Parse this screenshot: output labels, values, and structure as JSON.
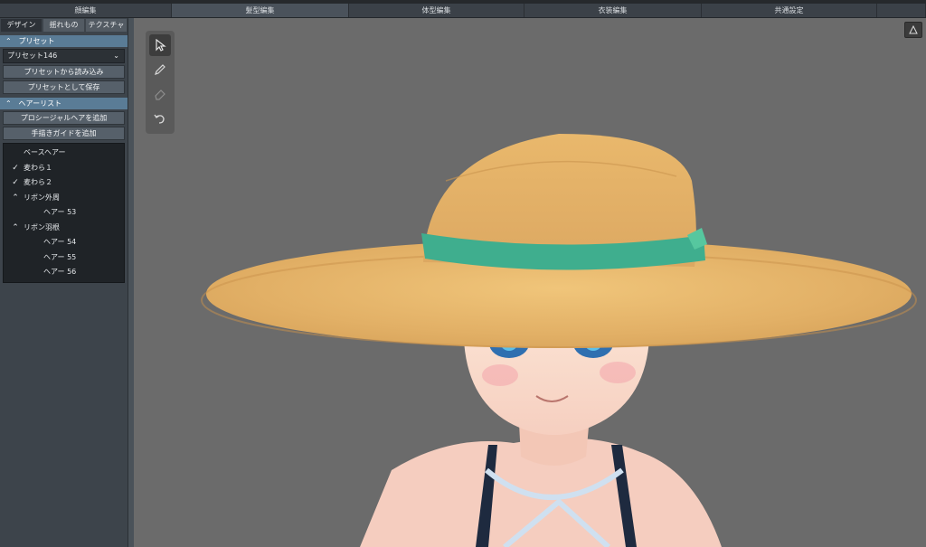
{
  "main_tabs": [
    "顔編集",
    "髪型編集",
    "体型編集",
    "衣装編集",
    "共通設定"
  ],
  "sub_tabs": [
    "デザイン",
    "揺れもの",
    "テクスチャ"
  ],
  "preset": {
    "header": "プリセット",
    "selected": "プリセット146",
    "load_button": "プリセットから読み込み",
    "save_button": "プリセットとして保存"
  },
  "hair_list": {
    "header": "ヘアーリスト",
    "add_procedural_button": "プロシージャルヘアを追加",
    "add_guide_button": "手描きガイドを追加",
    "items": [
      {
        "label": "ベースヘアー",
        "icon": "none",
        "level": 1
      },
      {
        "label": "麦わら１",
        "icon": "chevron-down",
        "level": 1
      },
      {
        "label": "麦わら２",
        "icon": "chevron-down",
        "level": 1
      },
      {
        "label": "リボン外周",
        "icon": "chevron-up",
        "level": 1
      },
      {
        "label": "ヘアー 53",
        "icon": "none",
        "level": 2
      },
      {
        "label": "リボン羽根",
        "icon": "chevron-up",
        "level": 1
      },
      {
        "label": "ヘアー 54",
        "icon": "none",
        "level": 2
      },
      {
        "label": "ヘアー 55",
        "icon": "none",
        "level": 2
      },
      {
        "label": "ヘアー 56",
        "icon": "none",
        "level": 2
      }
    ]
  },
  "tools": [
    "select-cursor-icon",
    "pen-icon",
    "eraser-icon",
    "undo-icon"
  ],
  "colors": {
    "viewport_bg": "#6b6b6b",
    "section_header": "#5a7c96",
    "hat_straw": "#e4b46a",
    "ribbon": "#3fae8e"
  }
}
